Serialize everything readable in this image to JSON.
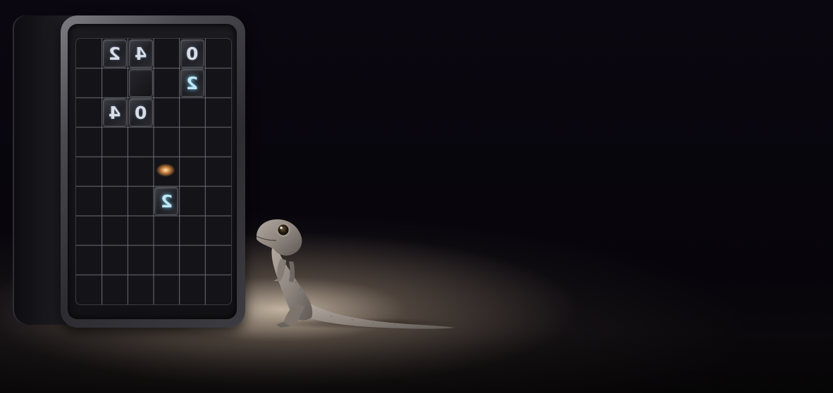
{
  "scene": {
    "description_tag": "gecko-facing-grid-puzzle",
    "colors": {
      "background": "#08060c",
      "spotlight": "#eedcc4",
      "gecko_skin": "#8d857e",
      "tile_glyph_cyan": "#bfe6f4",
      "spark": "#ffa046"
    }
  },
  "board": {
    "rows": 9,
    "cols": 6,
    "tiles": [
      {
        "glyph": "2",
        "style": "light",
        "row": 0,
        "col": 1
      },
      {
        "glyph": "4",
        "style": "light",
        "row": 0,
        "col": 2
      },
      {
        "glyph": "0",
        "style": "light",
        "row": 0,
        "col": 4
      },
      {
        "glyph": "",
        "style": "blank",
        "row": 1,
        "col": 2
      },
      {
        "glyph": "2",
        "style": "cyan",
        "row": 1,
        "col": 4
      },
      {
        "glyph": "4",
        "style": "light",
        "row": 2,
        "col": 1
      },
      {
        "glyph": "0",
        "style": "light",
        "row": 2,
        "col": 2
      },
      {
        "glyph": "2",
        "style": "cyan",
        "row": 5,
        "col": 3
      }
    ]
  }
}
